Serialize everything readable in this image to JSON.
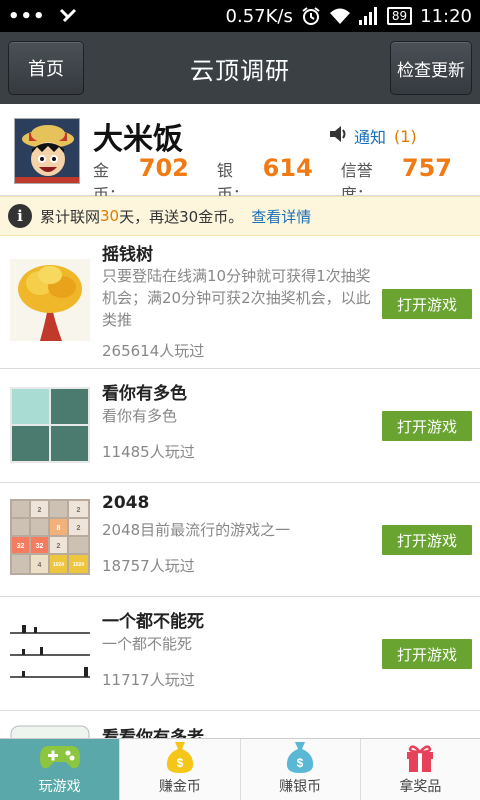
{
  "status_bar": {
    "net_speed": "0.57K/s",
    "battery": "89",
    "time": "11:20"
  },
  "header": {
    "home_label": "首页",
    "title": "云顶调研",
    "update_label": "检查更新"
  },
  "profile": {
    "username": "大米饭",
    "notify_label": "通知",
    "notify_count": "(1)",
    "gold_label": "金币：",
    "gold_value": "702",
    "silver_label": "银币：",
    "silver_value": "614",
    "credit_label": "信誉度：",
    "credit_value": "757"
  },
  "notice": {
    "prefix": "累计联网",
    "days": "30",
    "middle": "天，再送30金币。",
    "link": "查看详情"
  },
  "games": [
    {
      "name": "摇钱树",
      "desc": "只要登陆在线满10分钟就可获得1次抽奖机会；满20分钟可获2次抽奖机会，以此类推",
      "plays": "265614人玩过",
      "button": "打开游戏",
      "icon": "money-tree-icon"
    },
    {
      "name": "看你有多色",
      "desc": "看你有多色",
      "plays": "11485人玩过",
      "button": "打开游戏",
      "icon": "color-grid-icon"
    },
    {
      "name": "2048",
      "desc": "2048目前最流行的游戏之一",
      "plays": "18757人玩过",
      "button": "打开游戏",
      "icon": "2048-board-icon"
    },
    {
      "name": "一个都不能死",
      "desc": "一个都不能死",
      "plays": "11717人玩过",
      "button": "打开游戏",
      "icon": "runner-lanes-icon"
    },
    {
      "name": "看看你有多老",
      "icon": "age-icon"
    }
  ],
  "tile_values": {
    "r0": [
      "2",
      "2"
    ],
    "r1": [
      "8",
      "2"
    ],
    "r2": [
      "32",
      "32",
      "2"
    ],
    "r3": [
      "4",
      "1024",
      "1024"
    ]
  },
  "bottom_nav": [
    {
      "label": "玩游戏",
      "icon": "gamepad-icon",
      "active": true
    },
    {
      "label": "赚金币",
      "icon": "gold-money-bag-icon",
      "active": false
    },
    {
      "label": "赚银币",
      "icon": "silver-money-bag-icon",
      "active": false
    },
    {
      "label": "拿奖品",
      "icon": "gift-icon",
      "active": false
    }
  ],
  "colors": {
    "header_bg": "#3b4045",
    "accent_orange": "#f07a14",
    "link_blue": "#1a6fb5",
    "button_green": "#69a431",
    "nav_active": "#5aa8a9"
  }
}
